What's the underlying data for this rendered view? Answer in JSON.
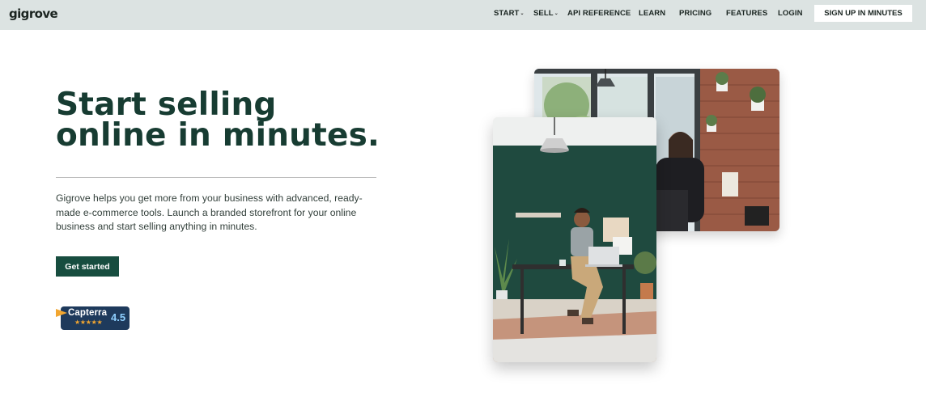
{
  "brand": {
    "logo_text": "gigrove"
  },
  "nav": {
    "items": [
      {
        "label": "START",
        "has_dropdown": true
      },
      {
        "label": "SELL",
        "has_dropdown": true
      },
      {
        "label": "API REFERENCE",
        "has_dropdown": false
      },
      {
        "label": "LEARN",
        "has_dropdown": false
      },
      {
        "label": "PRICING",
        "has_dropdown": false
      },
      {
        "label": "FEATURES",
        "has_dropdown": false
      },
      {
        "label": "LOGIN",
        "has_dropdown": false
      }
    ],
    "signup_label": "SIGN UP IN MINUTES",
    "dropdown_glyph": "⌄"
  },
  "hero": {
    "title": "Start selling online in minutes.",
    "description": "Gigrove helps you get more from your business with advanced, ready-made e-commerce tools. Launch a branded storefront for your online business and start selling anything in minutes.",
    "cta_label": "Get started"
  },
  "rating": {
    "provider": "Capterra",
    "score": "4.5",
    "stars": "★★★★★"
  },
  "images": {
    "back": "photo-cafe-brick-wall",
    "front": "photo-man-working-laptop-desk"
  },
  "colors": {
    "header_bg": "#dce3e2",
    "title": "#173c32",
    "cta_bg": "#174d3f",
    "capterra_bg": "#1e3a5c",
    "capterra_accent": "#f2a630"
  }
}
